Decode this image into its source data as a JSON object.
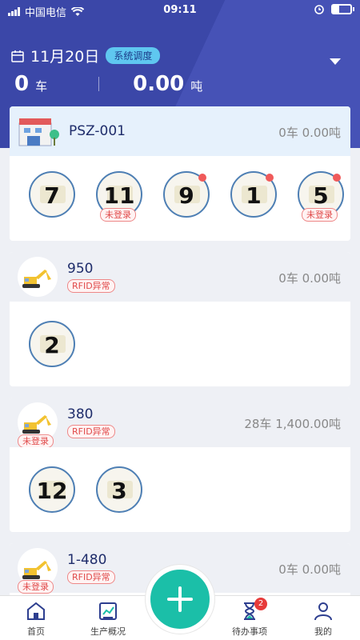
{
  "status_bar": {
    "carrier": "中国电信",
    "time": "09:11"
  },
  "header": {
    "date": "11月20日",
    "dispatch_badge": "系统调度",
    "total_trucks": "0",
    "total_trucks_unit": "车",
    "total_tons": "0.00",
    "total_tons_unit": "吨"
  },
  "cards": [
    {
      "name": "PSZ-001",
      "stat": "0车 0.00吨",
      "trucks": [
        {
          "num": "7"
        },
        {
          "num": "11",
          "tag": "未登录"
        },
        {
          "num": "9",
          "dot": true
        },
        {
          "num": "1",
          "dot": true
        },
        {
          "num": "5",
          "dot": true,
          "tag": "未登录"
        }
      ]
    },
    {
      "name": "950",
      "tag": "RFID异常",
      "stat": "0车 0.00吨",
      "trucks": [
        {
          "num": "2"
        }
      ]
    },
    {
      "name": "380",
      "tag": "RFID异常",
      "avatar_tag": "未登录",
      "stat": "28车 1,400.00吨",
      "trucks": [
        {
          "num": "12"
        },
        {
          "num": "3"
        }
      ]
    },
    {
      "name": "1-480",
      "tag": "RFID异常",
      "avatar_tag": "未登录",
      "stat": "0车 0.00吨"
    }
  ],
  "nav": {
    "home": "首页",
    "production": "生产概况",
    "todo": "待办事项",
    "todo_badge": "2",
    "mine": "我的"
  },
  "colors": {
    "header": "#3b47a8",
    "accent": "#1bbfa8",
    "alert": "#f05a5a"
  }
}
